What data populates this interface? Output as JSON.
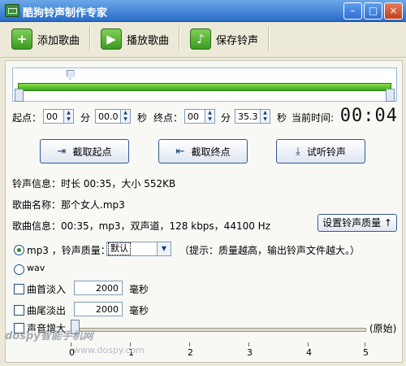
{
  "window": {
    "title": "酷狗铃声制作专家",
    "min_label": "–",
    "max_label": "□",
    "close_label": "×"
  },
  "toolbar": {
    "items": [
      {
        "label": "添加歌曲",
        "icon": "plus-icon",
        "glyph": "+"
      },
      {
        "label": "播放歌曲",
        "icon": "play-icon",
        "glyph": "▶"
      },
      {
        "label": "保存铃声",
        "icon": "music-note-icon",
        "glyph": "♪"
      }
    ]
  },
  "timeline": {
    "start_position_fraction": 0.13
  },
  "time_controls": {
    "start_label": "起点：",
    "start_min": "00",
    "min_unit": "分",
    "start_sec": "00.0",
    "sec_unit": "秒",
    "end_label": "终点：",
    "end_min": "00",
    "end_sec": "35.3",
    "current_time_label": "当前时间:",
    "current_time": "00:04"
  },
  "actions": {
    "cut_start": "截取起点",
    "cut_end": "截取终点",
    "preview": "试听铃声"
  },
  "info": {
    "ringtone_info": "铃声信息：时长 00:35，大小 552KB",
    "song_name": "歌曲名称：那个女人.mp3",
    "song_info": "歌曲信息：00:35，mp3，双声道，128 kbps，44100 Hz",
    "quality_button": "设置铃声质量 ↑"
  },
  "format": {
    "mp3_label": "mp3 ，铃声质量：",
    "mp3_selected": true,
    "quality_value": "默认",
    "hint": "（提示：质量越高，输出铃声文件越大。）",
    "wav_label": "wav"
  },
  "fade": {
    "fade_in_label": "曲首淡入",
    "fade_in_value": "2000",
    "fade_out_label": "曲尾淡出",
    "fade_out_value": "2000",
    "unit": "毫秒"
  },
  "volume": {
    "label": "声音增大",
    "level": 0,
    "original_label": "(原始)",
    "ticks": [
      "0",
      "1",
      "2",
      "3",
      "4",
      "5"
    ]
  },
  "watermark": {
    "text": "dospy智能手机网",
    "url": "www.dospy.com"
  }
}
